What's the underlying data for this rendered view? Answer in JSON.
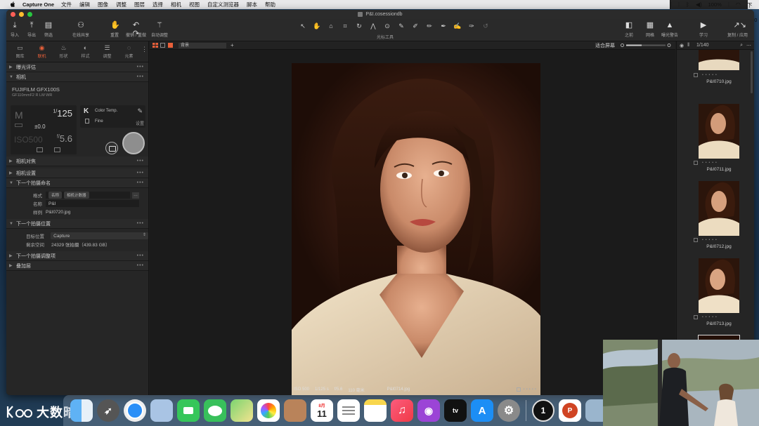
{
  "menubar": {
    "app": "Capture One",
    "items": [
      "文件",
      "编辑",
      "图像",
      "调整",
      "图层",
      "选择",
      "相机",
      "视图",
      "自定义测览器",
      "脚本",
      "帮助"
    ],
    "battery": "100%",
    "clock": "周五 下午 2:20"
  },
  "window": {
    "title": "P&I.cosessiondb"
  },
  "toolbar": {
    "import": "导入",
    "export": "导出",
    "filter": "筛选",
    "share": "在线共享",
    "reset": "重置",
    "undo_redo": "撤销 / 重做",
    "auto_adjust": "自动调整",
    "cursor_tools": "光标工具",
    "before": "之前",
    "grid": "网格",
    "exposure_warning": "曝光警告",
    "learn": "学习",
    "copy_apply": "复制 / 应用"
  },
  "left_tabs": [
    "图库",
    "联机",
    "形状",
    "样式",
    "调整",
    "元素"
  ],
  "sections": {
    "exposure_eval": "曝光评估",
    "camera": "相机",
    "camera_focus": "相机对焦",
    "camera_settings": "相机设置",
    "next_capture_naming": "下一个拍摄命名",
    "next_capture_location": "下一个拍摄位置",
    "next_capture_adjustments": "下一个拍摄调整项",
    "overlay": "叠加层"
  },
  "camera": {
    "model": "FUJIFILM GFX100S",
    "lens": "GF110mmF2 R LM WR",
    "mode": "M",
    "shutter_num": "1/",
    "shutter": "125",
    "ev": "±0.0",
    "iso": "ISO500",
    "aperture_prefix": "f/",
    "aperture": "5.6",
    "wb_letter": "K",
    "wb": "Color Temp.",
    "quality": "Fine",
    "settings_label": "设置"
  },
  "naming": {
    "format_label": "格式",
    "format_chips": [
      "名称",
      "相机计数器"
    ],
    "name_label": "名称",
    "name_value": "P&I",
    "sample_label": "样例",
    "sample_value": "P&I0720.jpg"
  },
  "location": {
    "target_label": "目标位置",
    "target_value": "Capture",
    "space_label": "剩余空间",
    "space_value": "24329 张拍摄（439.83 GB）"
  },
  "viewer": {
    "preset": "背景",
    "fit": "适合屏幕",
    "caption": {
      "iso": "ISO 500",
      "shutter": "1/125 s",
      "aperture": "f/5.6",
      "focal": "110 毫米",
      "filename": "P&I0714.jpg"
    }
  },
  "browser": {
    "count": "1/140",
    "thumbs": [
      "P&I0710.jpg",
      "P&I0711.jpg",
      "P&I0712.jpg",
      "P&I0713.jpg"
    ]
  },
  "watermark": {
    "text": "大数暗境"
  },
  "dock": {
    "calendar_month": "8月",
    "calendar_day": "11"
  },
  "colors": {
    "accent": "#e8603a",
    "panel": "#262626",
    "viewer": "#1b1b1b"
  }
}
